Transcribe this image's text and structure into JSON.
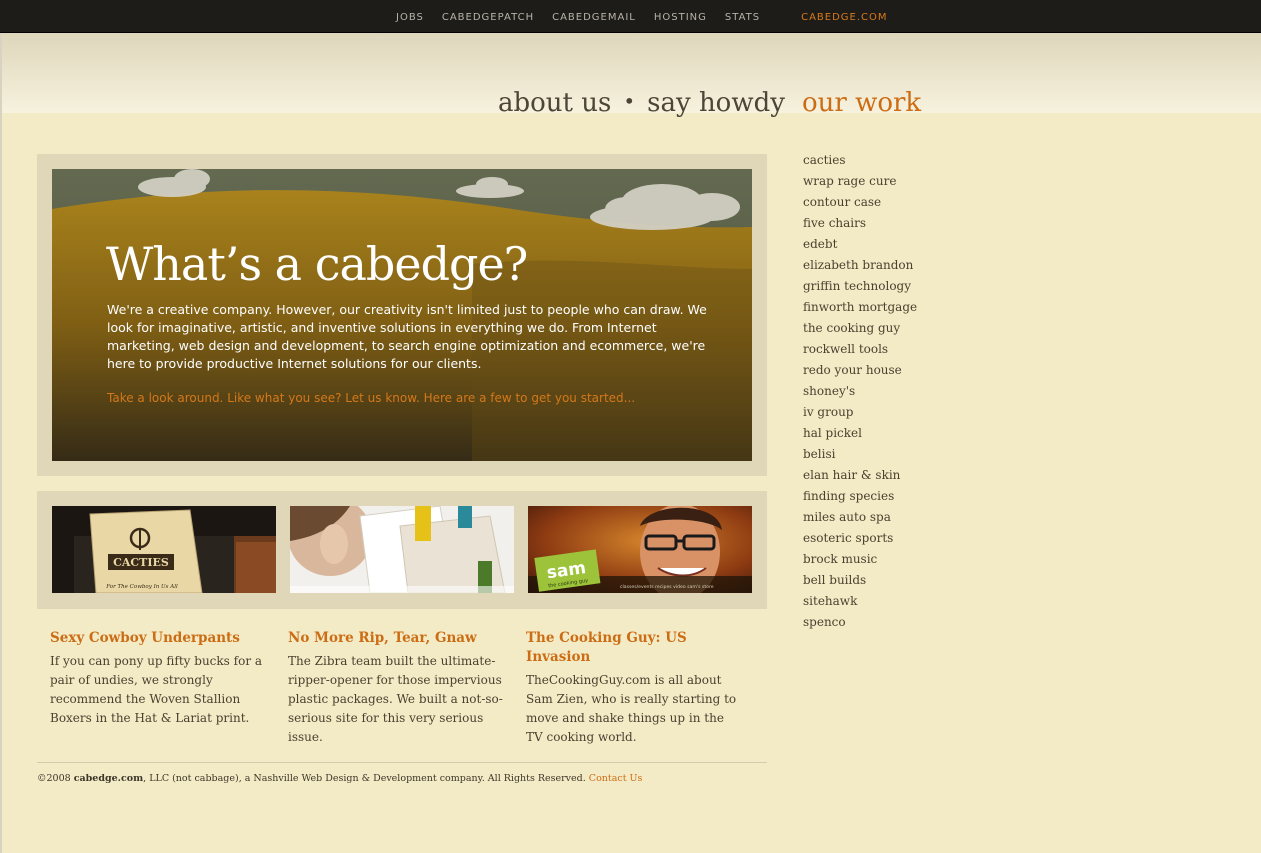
{
  "topnav": {
    "items": [
      "JOBS",
      "CABEDGEPATCH",
      "CABEDGEMAIL",
      "HOSTING",
      "STATS"
    ],
    "brand": "CABEDGE.COM"
  },
  "mainnav": {
    "about": "about us",
    "separator": "•",
    "howdy": "say howdy",
    "work": "our work"
  },
  "sidebar": {
    "items": [
      "cacties",
      "wrap rage cure",
      "contour case",
      "five chairs",
      "edebt",
      "elizabeth brandon",
      "griffin technology",
      "finworth mortgage",
      "the cooking guy",
      "rockwell tools",
      "redo your house",
      "shoney's",
      "iv group",
      "hal pickel",
      "belisi",
      "elan hair & skin",
      "finding species",
      "miles auto spa",
      "esoteric sports",
      "brock music",
      "bell builds",
      "sitehawk",
      "spenco"
    ]
  },
  "hero": {
    "title": "What’s a cabedge?",
    "body": "We're a creative company. However, our creativity isn't limited just to people who can draw. We look for imaginative, artistic, and inventive solutions in everything we do. From Internet marketing, web design and development, to search engine optimization and ecommerce, we're here to provide productive Internet solutions for our clients.",
    "cta": "Take a look around. Like what you see? Let us know. Here are a few to get you started..."
  },
  "thumbs": {
    "cacties": {
      "logo": "CACTIES",
      "tagline": "For The Cowboy In Us All"
    },
    "cooking": {
      "badge": "sam",
      "badge_sub": "the cooking guy",
      "menu": "classes/events   recipes   video   sam's store"
    }
  },
  "articles": [
    {
      "title": "Sexy Cowboy Underpants",
      "body": "If you can pony up fifty bucks for a pair of undies, we strongly recommend the Woven Stallion Boxers in the Hat & Lariat print."
    },
    {
      "title": "No More Rip, Tear, Gnaw",
      "body": "The Zibra team built the ultimate-ripper-opener for those impervious plastic packages. We built a not-so-serious site for this very serious issue."
    },
    {
      "title": "The Cooking Guy: US Invasion",
      "body": "TheCookingGuy.com is all about Sam Zien, who is really starting to move and shake things up in the TV cooking world."
    }
  ],
  "footer": {
    "copyright": "©2008",
    "company": "cabedge.com",
    "text": ", LLC (not cabbage), a Nashville Web Design & Development company. All Rights Reserved.",
    "contact": "Contact Us"
  },
  "colors": {
    "accent": "#cc6d15",
    "background": "#f3ebc6",
    "topbar": "#1e1c19",
    "frame": "#dfd7b8"
  }
}
